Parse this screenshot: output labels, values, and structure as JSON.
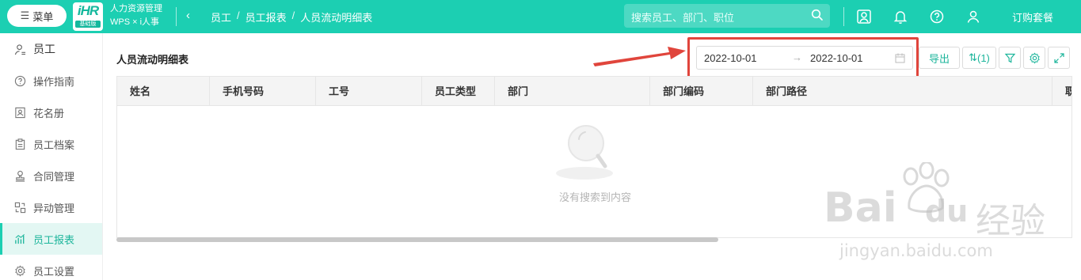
{
  "topbar": {
    "menu_label": "菜单",
    "logo_mark": "iHR",
    "logo_sub": "基础版",
    "brand_line1": "人力资源管理",
    "brand_line2": "WPS × i人事",
    "breadcrumb": [
      "员工",
      "员工报表",
      "人员流动明细表"
    ],
    "breadcrumb_sep": "/",
    "search_placeholder": "搜索员工、部门、职位",
    "subscribe_label": "订购套餐",
    "icons": [
      "search-icon",
      "org-chart-icon",
      "bell-icon",
      "help-icon",
      "user-icon"
    ]
  },
  "sidebar": {
    "items": [
      {
        "label": "员工",
        "icon": "person-icon"
      },
      {
        "label": "操作指南",
        "icon": "question-icon"
      },
      {
        "label": "花名册",
        "icon": "roster-icon"
      },
      {
        "label": "员工档案",
        "icon": "clipboard-icon"
      },
      {
        "label": "合同管理",
        "icon": "stamp-icon"
      },
      {
        "label": "异动管理",
        "icon": "change-icon"
      },
      {
        "label": "员工报表",
        "icon": "report-icon",
        "active": true
      },
      {
        "label": "员工设置",
        "icon": "gear-icon"
      }
    ]
  },
  "main": {
    "title": "人员流动明细表",
    "date_start": "2022-10-01",
    "date_sep": "→",
    "date_end": "2022-10-01",
    "export_label": "导出",
    "sort_label": "(1)",
    "columns": [
      "姓名",
      "手机号码",
      "工号",
      "员工类型",
      "部门",
      "部门编码",
      "部门路径",
      "职"
    ],
    "empty_text": "没有搜索到内容"
  },
  "watermark": {
    "brand_left": "Bai",
    "brand_right": "du",
    "brand_cn": "经验",
    "url": "jingyan.baidu.com"
  },
  "colors": {
    "accent": "#1ccfb2",
    "accent_dark": "#1cb59b",
    "highlight_red": "#e0453c"
  }
}
